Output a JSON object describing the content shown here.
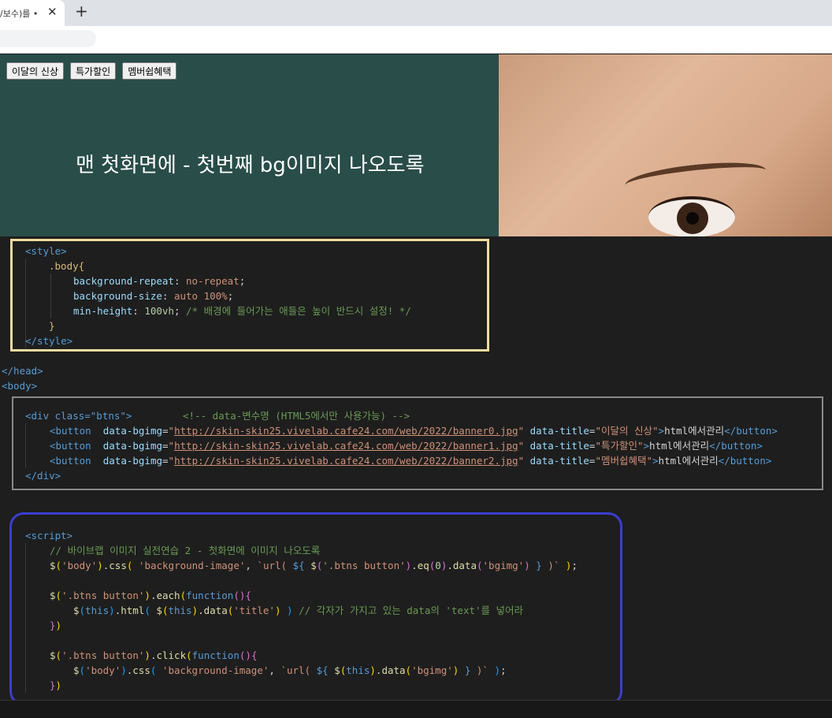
{
  "browser": {
    "tab_title": "/보수)를 •",
    "tab_close": "✕",
    "new_tab": "+"
  },
  "page": {
    "buttons": [
      "이달의 신상",
      "특가할인",
      "멤버쉽혜택"
    ],
    "hero_text": "맨 첫화면에 - 첫번째 bg이미지 나오도록",
    "background_color": "#294d48"
  },
  "code": {
    "style_open": "<style>",
    "body_selector": ".body{",
    "prop1": "background-repeat",
    "val1": "no-repeat",
    "prop2": "background-size",
    "val2": "auto 100%",
    "prop3": "min-height",
    "val3": "100vh",
    "comment1": "/* 배경에 들어가는 애들은 높이 반드시 설정! */",
    "close_brace": "}",
    "style_close": "</style>",
    "head_close": "</head>",
    "body_open": "<body>",
    "div_open": "<div class=\"btns\">",
    "div_comment": "<!-- data-변수명 (HTML5에서만 사용가능) -->",
    "button_lines": [
      {
        "url": "http://skin-skin25.vivelab.cafe24.com/web/2022/banner0.jpg",
        "title": "이달의 신상",
        "inner": "html에서관리"
      },
      {
        "url": "http://skin-skin25.vivelab.cafe24.com/web/2022/banner1.jpg",
        "title": "특가할인",
        "inner": "html에서관리"
      },
      {
        "url": "http://skin-skin25.vivelab.cafe24.com/web/2022/banner2.jpg",
        "title": "멤버쉽혜택",
        "inner": "html에서관리"
      }
    ],
    "div_close": "</div>",
    "script_open": "<script>",
    "comment2": "// 바이브랩 이미지 실전연습 2 - 첫화면에 이미지 나오도록",
    "comment3": "// 각자가 가지고 있는 data의 'text'를 넣어라"
  },
  "colors": {
    "box_style": "#f0dba0",
    "box_html": "#8a8a8a",
    "box_script": "#3a3ecf"
  }
}
